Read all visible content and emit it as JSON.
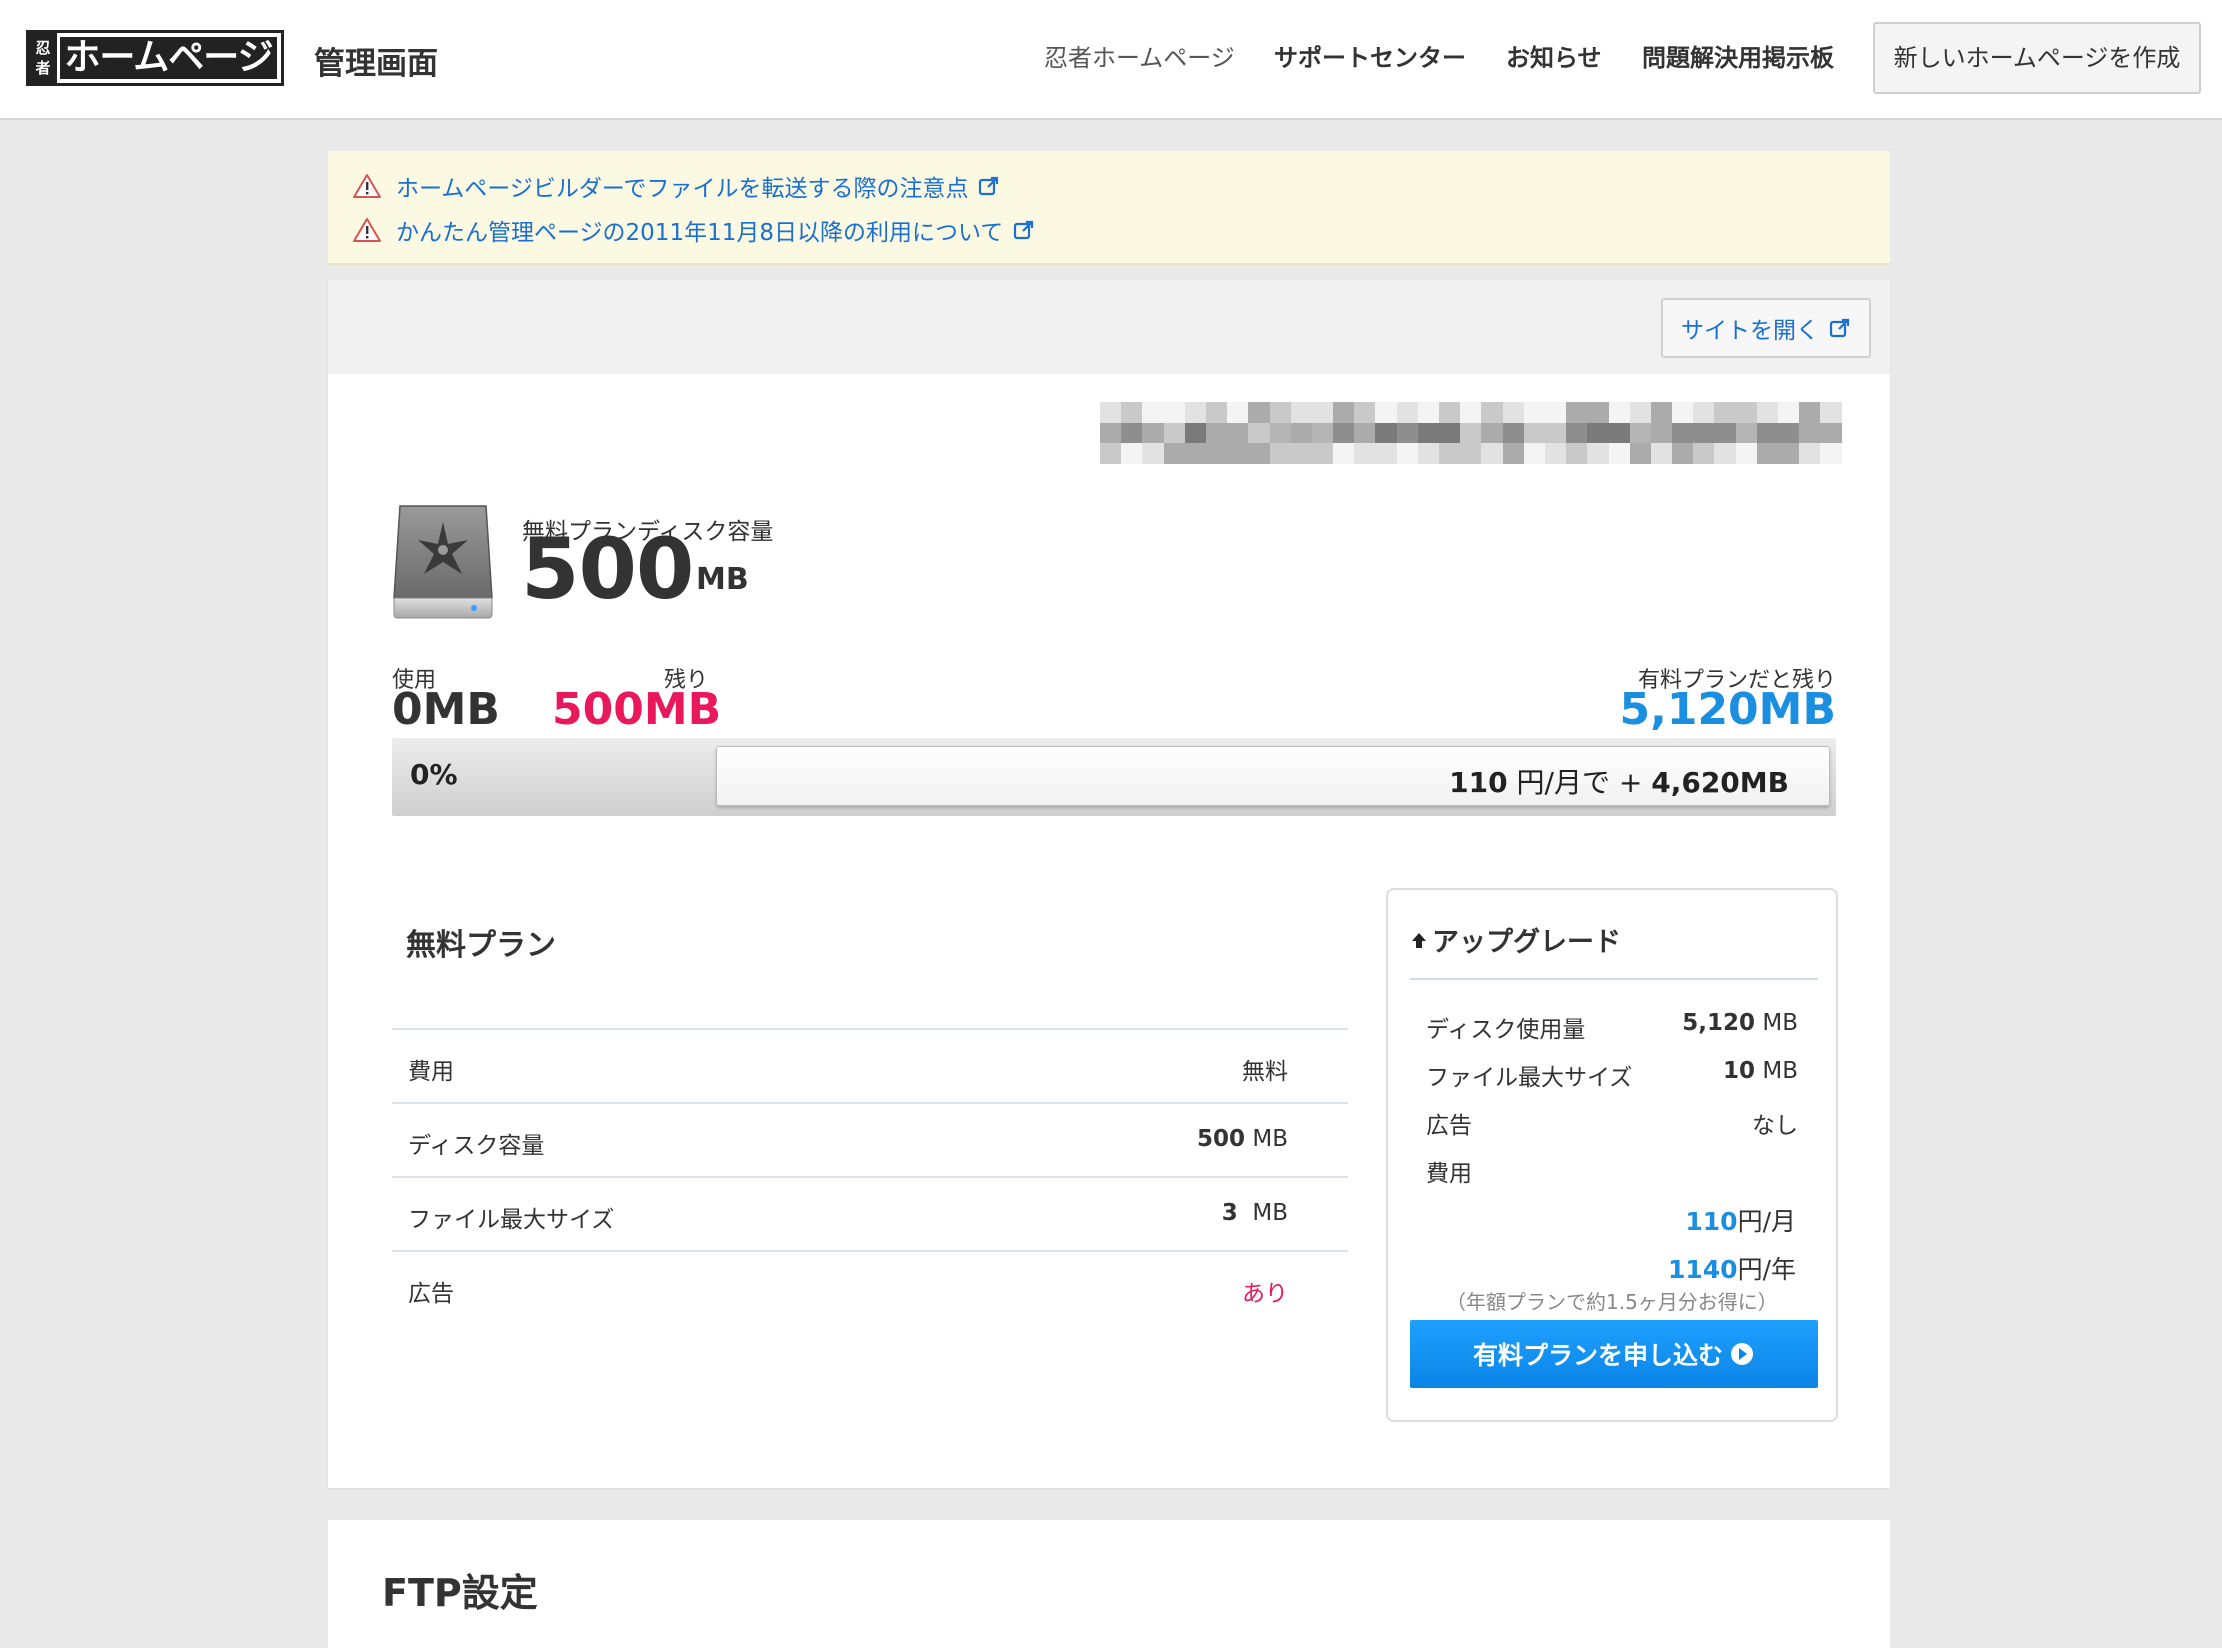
{
  "header": {
    "logo_kanji": [
      "忍",
      "者"
    ],
    "logo_text": "ホームページ",
    "admin_title": "管理画面",
    "nav": [
      {
        "label": "忍者ホームページ"
      },
      {
        "label": "サポートセンター"
      },
      {
        "label": "お知らせ"
      },
      {
        "label": "問題解決用掲示板"
      }
    ],
    "create_button": "新しいホームページを作成"
  },
  "notices": [
    {
      "text": "ホームページビルダーでファイルを転送する際の注意点"
    },
    {
      "text": "かんたん管理ページの2011年11月8日以降の利用について"
    }
  ],
  "site": {
    "open_button": "サイトを開く"
  },
  "disk": {
    "label": "無料プランディスク容量",
    "capacity": "500",
    "unit": "MB",
    "used_label": "使用",
    "used_value": "0MB",
    "remaining_label": "残り",
    "remaining_value": "500MB",
    "paid_remaining_label": "有料プランだと残り",
    "paid_remaining_value": "5,120MB",
    "usage_percent_text": "0%",
    "usage_fraction": 0,
    "bar_price": "110",
    "bar_price_unit": "円/月で +",
    "bar_extra": "4,620MB"
  },
  "free_plan": {
    "title": "無料プラン",
    "rows": [
      {
        "key": "費用",
        "value": "無料",
        "unit": ""
      },
      {
        "key": "ディスク容量",
        "value": "500",
        "unit": "MB"
      },
      {
        "key": "ファイル最大サイズ",
        "value": "3",
        "unit": "MB"
      },
      {
        "key": "広告",
        "value": "あり",
        "unit": ""
      }
    ]
  },
  "upgrade": {
    "title": "アップグレード",
    "rows": [
      {
        "key": "ディスク使用量",
        "value": "5,120",
        "unit": "MB"
      },
      {
        "key": "ファイル最大サイズ",
        "value": "10",
        "unit": "MB"
      },
      {
        "key": "広告",
        "value": "",
        "unit": "なし"
      },
      {
        "key": "費用",
        "value": "",
        "unit": ""
      }
    ],
    "monthly_price": "110",
    "monthly_unit": "円/月",
    "yearly_price": "1140",
    "yearly_unit": "円/年",
    "note": "（年額プランで約1.5ヶ月分お得に）",
    "apply_button": "有料プランを申し込む"
  },
  "ftp": {
    "title": "FTP設定"
  },
  "colors": {
    "link": "#1a6fd1",
    "remaining": "#e8185a",
    "paid": "#1a8ee0",
    "notice_bg": "#fbf9e2"
  }
}
